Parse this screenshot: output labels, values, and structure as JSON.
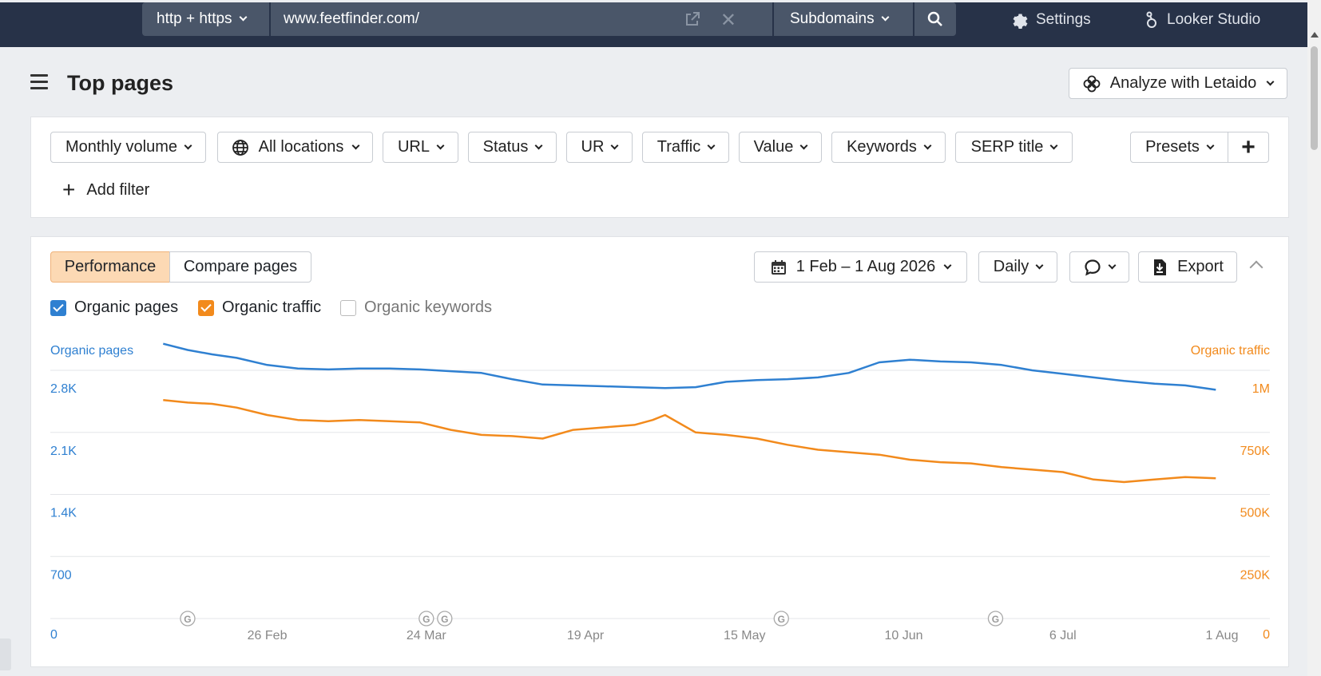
{
  "topbar": {
    "protocol": "http + https",
    "url": "www.feetfinder.com/",
    "mode": "Subdomains",
    "settings": "Settings",
    "looker": "Looker Studio"
  },
  "header": {
    "title": "Top pages",
    "analyze": "Analyze with Letaido"
  },
  "filters": {
    "items": [
      "Monthly volume",
      "All locations",
      "URL",
      "Status",
      "UR",
      "Traffic",
      "Value",
      "Keywords",
      "SERP title"
    ],
    "presets": "Presets",
    "add_filter": "Add filter"
  },
  "performance": {
    "tabs": [
      "Performance",
      "Compare pages"
    ],
    "date_range": "1 Feb – 1 Aug 2026",
    "interval": "Daily",
    "export": "Export",
    "checkboxes": [
      {
        "label": "Organic pages",
        "checked": true,
        "color": "#2f80d1"
      },
      {
        "label": "Organic traffic",
        "checked": true,
        "color": "#f28a1c"
      },
      {
        "label": "Organic keywords",
        "checked": false,
        "color": "#888888"
      }
    ]
  },
  "chart_data": {
    "type": "line",
    "left_axis_title": "Organic pages",
    "right_axis_title": "Organic traffic",
    "left_ticks": [
      "0",
      "700",
      "1.4K",
      "2.1K",
      "2.8K"
    ],
    "right_ticks": [
      "0",
      "250K",
      "500K",
      "750K",
      "1M"
    ],
    "left_ylim": [
      0,
      2800
    ],
    "right_ylim": [
      0,
      1000000
    ],
    "x_ticks": [
      "26 Feb",
      "24 Mar",
      "19 Apr",
      "15 May",
      "10 Jun",
      "6 Jul",
      "1 Aug"
    ],
    "x_tick_days": [
      25,
      51,
      77,
      103,
      129,
      155,
      181
    ],
    "xlim_days": [
      0,
      181
    ],
    "google_update_days": [
      12,
      51,
      54,
      109,
      144
    ],
    "google_marker": "G",
    "series": [
      {
        "name": "Organic pages",
        "axis": "left",
        "color": "#2f80d1",
        "points": [
          [
            8,
            3100
          ],
          [
            12,
            3030
          ],
          [
            16,
            2980
          ],
          [
            20,
            2940
          ],
          [
            25,
            2860
          ],
          [
            30,
            2820
          ],
          [
            35,
            2810
          ],
          [
            40,
            2820
          ],
          [
            45,
            2820
          ],
          [
            50,
            2810
          ],
          [
            55,
            2790
          ],
          [
            60,
            2770
          ],
          [
            65,
            2700
          ],
          [
            70,
            2640
          ],
          [
            75,
            2630
          ],
          [
            80,
            2620
          ],
          [
            85,
            2610
          ],
          [
            90,
            2600
          ],
          [
            95,
            2610
          ],
          [
            100,
            2670
          ],
          [
            105,
            2690
          ],
          [
            110,
            2700
          ],
          [
            115,
            2720
          ],
          [
            120,
            2770
          ],
          [
            125,
            2890
          ],
          [
            130,
            2920
          ],
          [
            135,
            2900
          ],
          [
            140,
            2890
          ],
          [
            145,
            2860
          ],
          [
            150,
            2800
          ],
          [
            155,
            2760
          ],
          [
            160,
            2720
          ],
          [
            165,
            2680
          ],
          [
            170,
            2650
          ],
          [
            175,
            2630
          ],
          [
            180,
            2580
          ]
        ]
      },
      {
        "name": "Organic traffic",
        "axis": "right",
        "color": "#f28a1c",
        "points": [
          [
            8,
            880
          ],
          [
            12,
            870
          ],
          [
            16,
            865
          ],
          [
            20,
            850
          ],
          [
            25,
            820
          ],
          [
            30,
            800
          ],
          [
            35,
            795
          ],
          [
            40,
            800
          ],
          [
            45,
            795
          ],
          [
            50,
            790
          ],
          [
            55,
            760
          ],
          [
            60,
            740
          ],
          [
            65,
            735
          ],
          [
            70,
            725
          ],
          [
            75,
            760
          ],
          [
            80,
            770
          ],
          [
            85,
            780
          ],
          [
            88,
            800
          ],
          [
            90,
            820
          ],
          [
            95,
            750
          ],
          [
            100,
            740
          ],
          [
            105,
            725
          ],
          [
            110,
            700
          ],
          [
            115,
            680
          ],
          [
            120,
            670
          ],
          [
            125,
            660
          ],
          [
            130,
            640
          ],
          [
            135,
            630
          ],
          [
            140,
            625
          ],
          [
            145,
            610
          ],
          [
            150,
            600
          ],
          [
            155,
            590
          ],
          [
            160,
            560
          ],
          [
            165,
            550
          ],
          [
            170,
            560
          ],
          [
            175,
            570
          ],
          [
            180,
            565
          ]
        ]
      }
    ]
  }
}
